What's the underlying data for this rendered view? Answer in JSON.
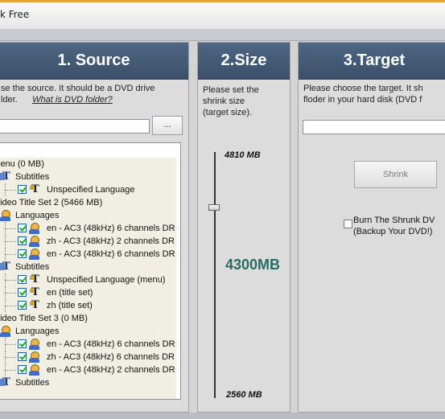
{
  "window": {
    "title": "k Free"
  },
  "source": {
    "header": "1. Source",
    "desc_line1": "se the source. It should be a DVD drive",
    "desc_line2": "lder.",
    "desc_link": "What is DVD folder?",
    "browse_label": "...",
    "path_value": "",
    "tree": [
      {
        "text": "lenu (0 MB)",
        "icon": "",
        "checkbox": false,
        "indent": 0
      },
      {
        "text": "Subtitles",
        "icon": "subtitles-icon",
        "checkbox": false,
        "indent": 1
      },
      {
        "text": "Unspecified Language",
        "icon": "text-icon",
        "checkbox": true,
        "indent": 2
      },
      {
        "text": "'ideo Title Set 2 (5466 MB)",
        "icon": "",
        "checkbox": false,
        "indent": 0
      },
      {
        "text": "Languages",
        "icon": "language-icon",
        "checkbox": false,
        "indent": 1
      },
      {
        "text": "en - AC3 (48kHz) 6 channels DR",
        "icon": "language-icon",
        "checkbox": true,
        "indent": 2
      },
      {
        "text": "zh - AC3 (48kHz) 2 channels DR",
        "icon": "language-icon",
        "checkbox": true,
        "indent": 2
      },
      {
        "text": "en - AC3 (48kHz) 6 channels DR",
        "icon": "language-icon",
        "checkbox": true,
        "indent": 2
      },
      {
        "text": "Subtitles",
        "icon": "subtitles-icon",
        "checkbox": false,
        "indent": 1
      },
      {
        "text": "Unspecified Language (menu)",
        "icon": "text-icon",
        "checkbox": true,
        "indent": 2
      },
      {
        "text": "en (title set)",
        "icon": "text-icon",
        "checkbox": true,
        "indent": 2
      },
      {
        "text": "zh (title set)",
        "icon": "text-icon",
        "checkbox": true,
        "indent": 2
      },
      {
        "text": "'ideo Title Set 3 (0 MB)",
        "icon": "",
        "checkbox": false,
        "indent": 0
      },
      {
        "text": "Languages",
        "icon": "language-icon",
        "checkbox": false,
        "indent": 1
      },
      {
        "text": "en - AC3 (48kHz) 6 channels DR",
        "icon": "language-icon",
        "checkbox": true,
        "indent": 2
      },
      {
        "text": "zh - AC3 (48kHz) 6 channels DR",
        "icon": "language-icon",
        "checkbox": true,
        "indent": 2
      },
      {
        "text": "en - AC3 (48kHz) 2 channels DR",
        "icon": "language-icon",
        "checkbox": true,
        "indent": 2
      },
      {
        "text": "Subtitles",
        "icon": "subtitles-icon",
        "checkbox": false,
        "indent": 1
      }
    ]
  },
  "size": {
    "header": "2.Size",
    "desc": [
      "Please set the",
      "shrink size",
      "(target size)."
    ],
    "max_label": "4810 MB",
    "min_label": "2560 MB",
    "current_label": "4300MB",
    "slider_fraction": 0.773
  },
  "target": {
    "header": "3.Target",
    "desc_line1": "Please choose the target. It sh",
    "desc_line2": "floder in your hard disk (DVD f",
    "path_value": "",
    "shrink_label": "Shrink",
    "burn_line1": "Burn The Shrunk DV",
    "burn_line2": "(Backup Your DVD!)",
    "burn_checked": false
  }
}
